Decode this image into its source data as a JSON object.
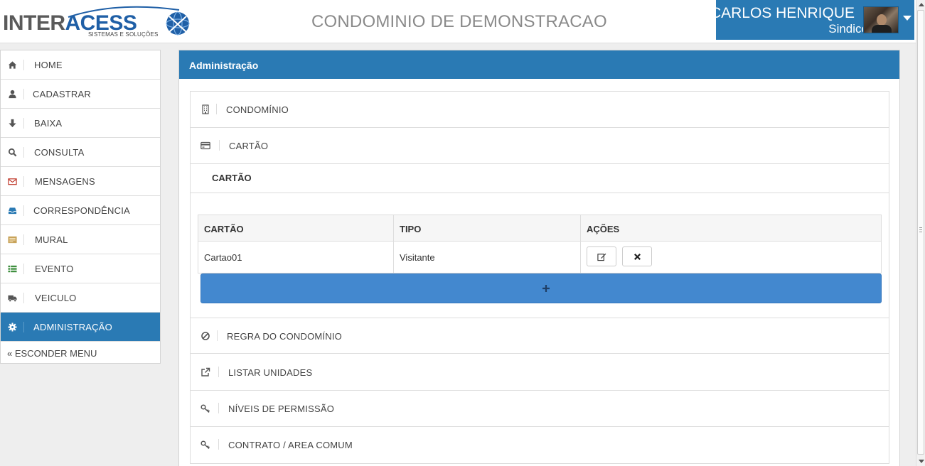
{
  "header": {
    "logo": {
      "word_left": "INTER",
      "word_right": "ACESS",
      "tagline": "SISTEMAS E SOLUÇÕES"
    },
    "title": "CONDOMINIO DE DEMONSTRACAO",
    "user": {
      "name": "CARLOS HENRIQUE",
      "role": "Sindico"
    }
  },
  "sidebar": {
    "items": [
      {
        "label": "HOME",
        "icon": "home-icon",
        "color": "#555555"
      },
      {
        "label": "CADASTRAR",
        "icon": "user-icon",
        "color": "#555555"
      },
      {
        "label": "BAIXA",
        "icon": "arrow-down-icon",
        "color": "#555555"
      },
      {
        "label": "CONSULTA",
        "icon": "search-icon",
        "color": "#555555"
      },
      {
        "label": "MENSAGENS",
        "icon": "envelope-icon",
        "color": "#c0392b"
      },
      {
        "label": "CORRESPONDÊNCIA",
        "icon": "inbox-icon",
        "color": "#2a7ab4"
      },
      {
        "label": "MURAL",
        "icon": "board-icon",
        "color": "#c8a35a"
      },
      {
        "label": "EVENTO",
        "icon": "list-icon",
        "color": "#3f8f3f"
      },
      {
        "label": "VEICULO",
        "icon": "truck-icon",
        "color": "#555555"
      },
      {
        "label": "ADMINISTRAÇÃO",
        "icon": "gear-icon",
        "color": "#ffffff",
        "active": true
      }
    ],
    "hide_menu": "« ESCONDER MENU"
  },
  "main": {
    "panel_title": "Administração",
    "sections": [
      {
        "label": "CONDOMÍNIO",
        "icon": "building-icon"
      },
      {
        "label": "CARTÃO",
        "icon": "credit-card-icon",
        "expanded": true
      },
      {
        "label": "REGRA DO CONDOMÍNIO",
        "icon": "ban-icon"
      },
      {
        "label": "LISTAR UNIDADES",
        "icon": "external-link-icon"
      },
      {
        "label": "NÍVEIS DE PERMISSÃO",
        "icon": "key-icon"
      },
      {
        "label": "CONTRATO / AREA COMUM",
        "icon": "key-icon"
      }
    ],
    "card_section": {
      "subtitle": "CARTÃO",
      "table": {
        "headers": [
          "CARTÃO",
          "TIPO",
          "AÇÕES"
        ],
        "rows": [
          {
            "cartao": "Cartao01",
            "tipo": "Visitante"
          }
        ]
      },
      "add_button": "+"
    }
  },
  "colors": {
    "primary": "#2a7ab4",
    "add_button": "#4388cf"
  }
}
